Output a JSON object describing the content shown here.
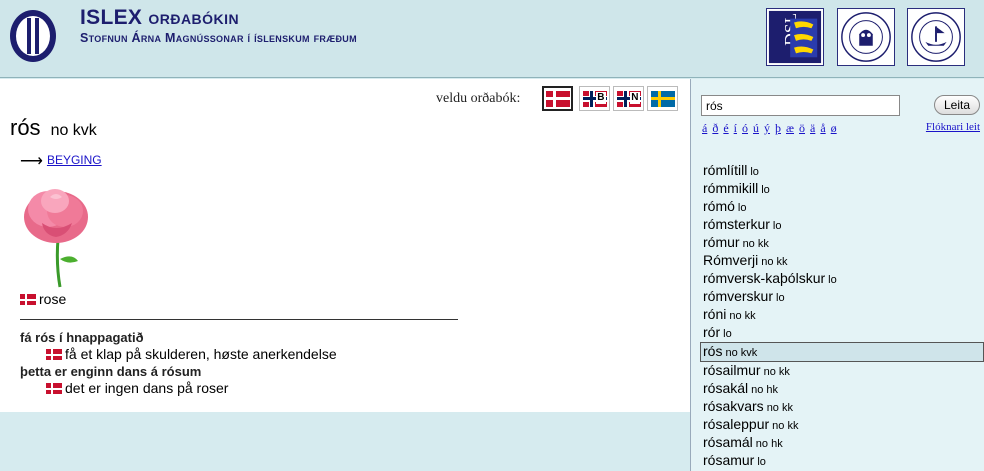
{
  "header": {
    "title_main": "ISLEX",
    "title_sub": "ORÐABÓKIN",
    "subtitle": "Stofnun Árna Magnússonar í íslenskum fræðum",
    "institutions": [
      "DSL",
      "Universitas Bergensis",
      "Universitas Gothoburgensis"
    ]
  },
  "dictionary": {
    "select_label": "veldu orðabók:",
    "flags": [
      {
        "name": "danish",
        "selected": true
      },
      {
        "name": "norwegian-bokmal",
        "letter": "B",
        "selected": false
      },
      {
        "name": "norwegian-nynorsk",
        "letter": "N",
        "selected": false
      },
      {
        "name": "swedish",
        "selected": false
      }
    ]
  },
  "entry": {
    "headword": "rós",
    "pos": "no kvk",
    "beyging_label": "BEYGING",
    "translation": "rose",
    "examples": [
      {
        "source": "fá rós í hnappagatið",
        "target": "få et klap på skulderen, høste anerkendelse"
      },
      {
        "source": "þetta er enginn dans á rósum",
        "target": "det er ingen dans på roser"
      }
    ]
  },
  "sidebar": {
    "search_value": "rós",
    "search_button": "Leita",
    "chars": [
      "á",
      "ð",
      "é",
      "í",
      "ó",
      "ú",
      "ý",
      "þ",
      "æ",
      "ö",
      "ä",
      "å",
      "ø"
    ],
    "advanced_link": "Flóknari leit",
    "words": [
      {
        "word": "rómlítill",
        "tag": "lo"
      },
      {
        "word": "rómmikill",
        "tag": "lo"
      },
      {
        "word": "rómó",
        "tag": "lo"
      },
      {
        "word": "rómsterkur",
        "tag": "lo"
      },
      {
        "word": "rómur",
        "tag": "no kk"
      },
      {
        "word": "Rómverji",
        "tag": "no kk"
      },
      {
        "word": "rómversk-kaþólskur",
        "tag": "lo"
      },
      {
        "word": "rómverskur",
        "tag": "lo"
      },
      {
        "word": "róni",
        "tag": "no kk"
      },
      {
        "word": "rór",
        "tag": "lo"
      },
      {
        "word": "rós",
        "tag": "no kvk",
        "active": true
      },
      {
        "word": "rósailmur",
        "tag": "no kk"
      },
      {
        "word": "rósakál",
        "tag": "no hk"
      },
      {
        "word": "rósakvars",
        "tag": "no kk"
      },
      {
        "word": "rósaleppur",
        "tag": "no kk"
      },
      {
        "word": "rósamál",
        "tag": "no hk"
      },
      {
        "word": "rósamur",
        "tag": "lo"
      }
    ]
  },
  "colors": {
    "brand": "#1d1e6e",
    "header_bg": "#cfe6ea",
    "link": "#1a13c9"
  }
}
